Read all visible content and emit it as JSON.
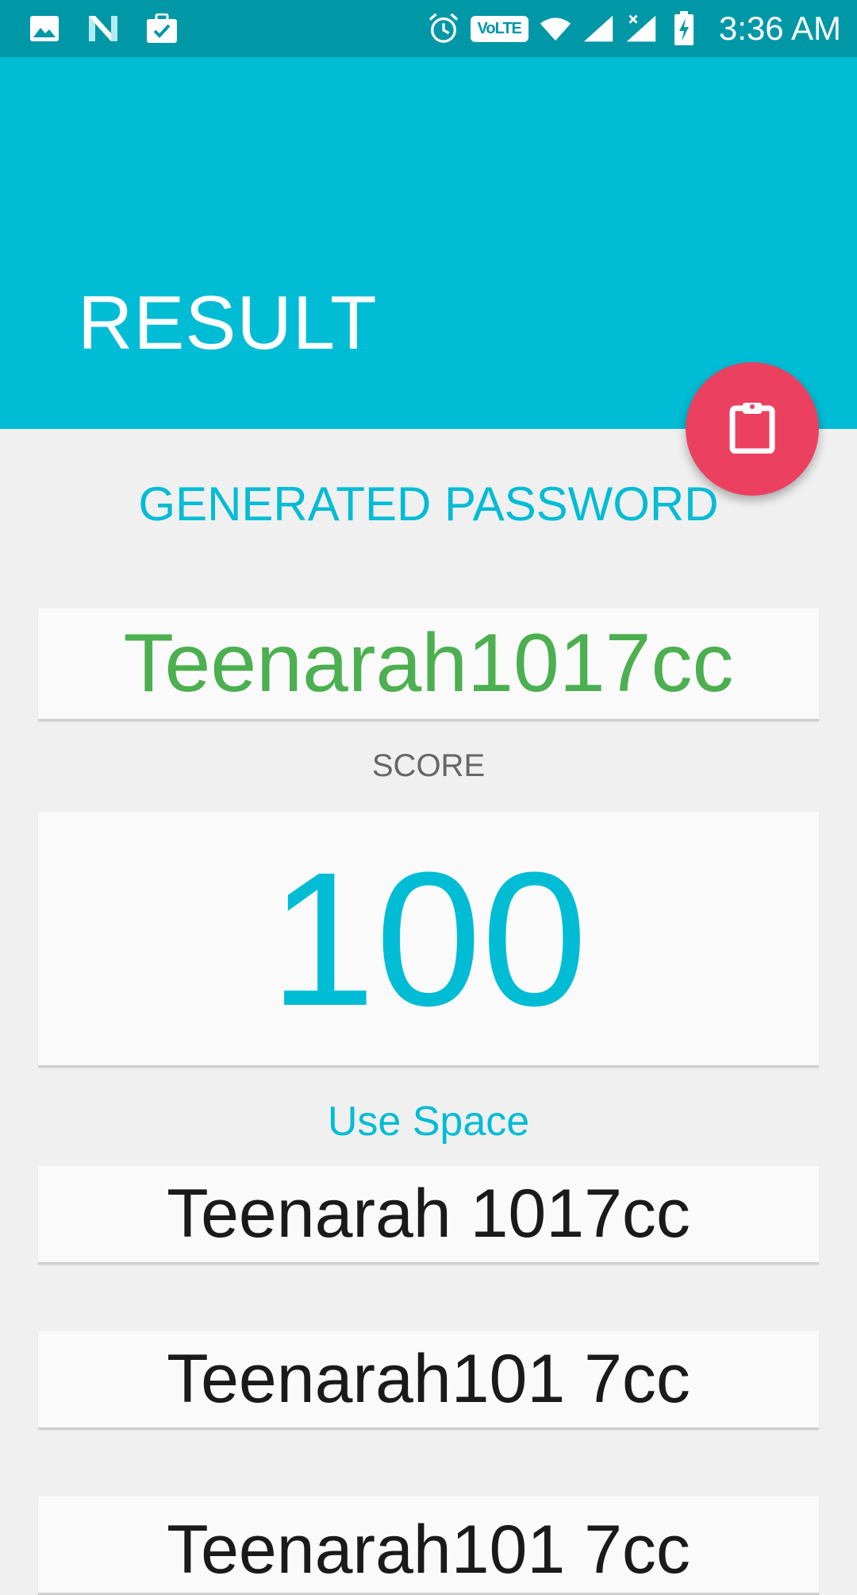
{
  "status_bar": {
    "time": "3:36 AM",
    "volte_label": "VoLTE",
    "icons": [
      "image-icon",
      "n-logo-icon",
      "briefcase-check-icon",
      "alarm-icon",
      "volte-icon",
      "wifi-icon",
      "signal-icon",
      "signal-no-data-icon",
      "battery-charging-icon"
    ]
  },
  "app_bar": {
    "title": "RESULT",
    "color": "#00bcd4"
  },
  "fab": {
    "icon": "clipboard-icon",
    "color": "#ec4060"
  },
  "generated": {
    "heading": "GENERATED PASSWORD",
    "password": "Teenarah1017cc",
    "password_color": "#4caf50"
  },
  "score": {
    "label": "SCORE",
    "value": "100"
  },
  "use_space": {
    "heading": "Use Space",
    "variants": [
      "Teenarah 1017cc",
      "Teenarah101 7cc",
      "Teenarah101 7cc"
    ]
  }
}
